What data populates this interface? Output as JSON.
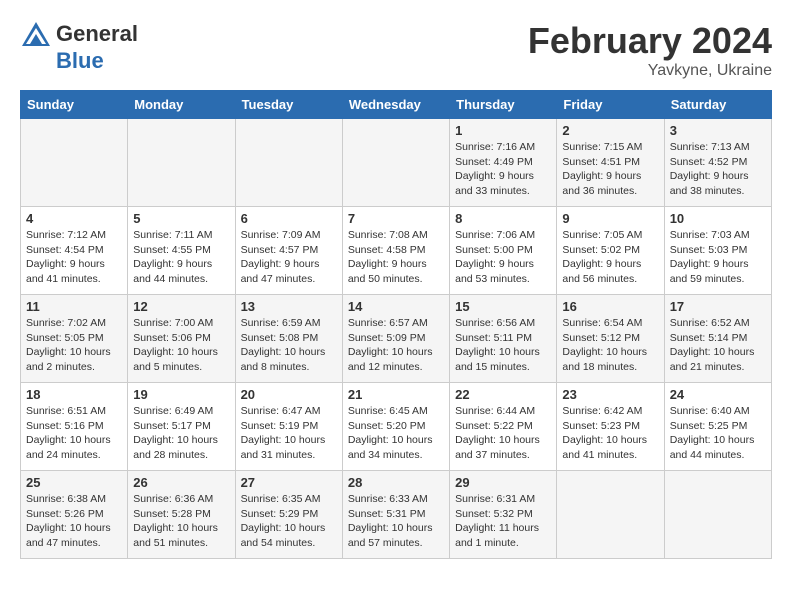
{
  "header": {
    "logo_general": "General",
    "logo_blue": "Blue",
    "month_title": "February 2024",
    "location": "Yavkyne, Ukraine"
  },
  "columns": [
    "Sunday",
    "Monday",
    "Tuesday",
    "Wednesday",
    "Thursday",
    "Friday",
    "Saturday"
  ],
  "weeks": [
    [
      {
        "day": "",
        "info": ""
      },
      {
        "day": "",
        "info": ""
      },
      {
        "day": "",
        "info": ""
      },
      {
        "day": "",
        "info": ""
      },
      {
        "day": "1",
        "info": "Sunrise: 7:16 AM\nSunset: 4:49 PM\nDaylight: 9 hours\nand 33 minutes."
      },
      {
        "day": "2",
        "info": "Sunrise: 7:15 AM\nSunset: 4:51 PM\nDaylight: 9 hours\nand 36 minutes."
      },
      {
        "day": "3",
        "info": "Sunrise: 7:13 AM\nSunset: 4:52 PM\nDaylight: 9 hours\nand 38 minutes."
      }
    ],
    [
      {
        "day": "4",
        "info": "Sunrise: 7:12 AM\nSunset: 4:54 PM\nDaylight: 9 hours\nand 41 minutes."
      },
      {
        "day": "5",
        "info": "Sunrise: 7:11 AM\nSunset: 4:55 PM\nDaylight: 9 hours\nand 44 minutes."
      },
      {
        "day": "6",
        "info": "Sunrise: 7:09 AM\nSunset: 4:57 PM\nDaylight: 9 hours\nand 47 minutes."
      },
      {
        "day": "7",
        "info": "Sunrise: 7:08 AM\nSunset: 4:58 PM\nDaylight: 9 hours\nand 50 minutes."
      },
      {
        "day": "8",
        "info": "Sunrise: 7:06 AM\nSunset: 5:00 PM\nDaylight: 9 hours\nand 53 minutes."
      },
      {
        "day": "9",
        "info": "Sunrise: 7:05 AM\nSunset: 5:02 PM\nDaylight: 9 hours\nand 56 minutes."
      },
      {
        "day": "10",
        "info": "Sunrise: 7:03 AM\nSunset: 5:03 PM\nDaylight: 9 hours\nand 59 minutes."
      }
    ],
    [
      {
        "day": "11",
        "info": "Sunrise: 7:02 AM\nSunset: 5:05 PM\nDaylight: 10 hours\nand 2 minutes."
      },
      {
        "day": "12",
        "info": "Sunrise: 7:00 AM\nSunset: 5:06 PM\nDaylight: 10 hours\nand 5 minutes."
      },
      {
        "day": "13",
        "info": "Sunrise: 6:59 AM\nSunset: 5:08 PM\nDaylight: 10 hours\nand 8 minutes."
      },
      {
        "day": "14",
        "info": "Sunrise: 6:57 AM\nSunset: 5:09 PM\nDaylight: 10 hours\nand 12 minutes."
      },
      {
        "day": "15",
        "info": "Sunrise: 6:56 AM\nSunset: 5:11 PM\nDaylight: 10 hours\nand 15 minutes."
      },
      {
        "day": "16",
        "info": "Sunrise: 6:54 AM\nSunset: 5:12 PM\nDaylight: 10 hours\nand 18 minutes."
      },
      {
        "day": "17",
        "info": "Sunrise: 6:52 AM\nSunset: 5:14 PM\nDaylight: 10 hours\nand 21 minutes."
      }
    ],
    [
      {
        "day": "18",
        "info": "Sunrise: 6:51 AM\nSunset: 5:16 PM\nDaylight: 10 hours\nand 24 minutes."
      },
      {
        "day": "19",
        "info": "Sunrise: 6:49 AM\nSunset: 5:17 PM\nDaylight: 10 hours\nand 28 minutes."
      },
      {
        "day": "20",
        "info": "Sunrise: 6:47 AM\nSunset: 5:19 PM\nDaylight: 10 hours\nand 31 minutes."
      },
      {
        "day": "21",
        "info": "Sunrise: 6:45 AM\nSunset: 5:20 PM\nDaylight: 10 hours\nand 34 minutes."
      },
      {
        "day": "22",
        "info": "Sunrise: 6:44 AM\nSunset: 5:22 PM\nDaylight: 10 hours\nand 37 minutes."
      },
      {
        "day": "23",
        "info": "Sunrise: 6:42 AM\nSunset: 5:23 PM\nDaylight: 10 hours\nand 41 minutes."
      },
      {
        "day": "24",
        "info": "Sunrise: 6:40 AM\nSunset: 5:25 PM\nDaylight: 10 hours\nand 44 minutes."
      }
    ],
    [
      {
        "day": "25",
        "info": "Sunrise: 6:38 AM\nSunset: 5:26 PM\nDaylight: 10 hours\nand 47 minutes."
      },
      {
        "day": "26",
        "info": "Sunrise: 6:36 AM\nSunset: 5:28 PM\nDaylight: 10 hours\nand 51 minutes."
      },
      {
        "day": "27",
        "info": "Sunrise: 6:35 AM\nSunset: 5:29 PM\nDaylight: 10 hours\nand 54 minutes."
      },
      {
        "day": "28",
        "info": "Sunrise: 6:33 AM\nSunset: 5:31 PM\nDaylight: 10 hours\nand 57 minutes."
      },
      {
        "day": "29",
        "info": "Sunrise: 6:31 AM\nSunset: 5:32 PM\nDaylight: 11 hours\nand 1 minute."
      },
      {
        "day": "",
        "info": ""
      },
      {
        "day": "",
        "info": ""
      }
    ]
  ]
}
